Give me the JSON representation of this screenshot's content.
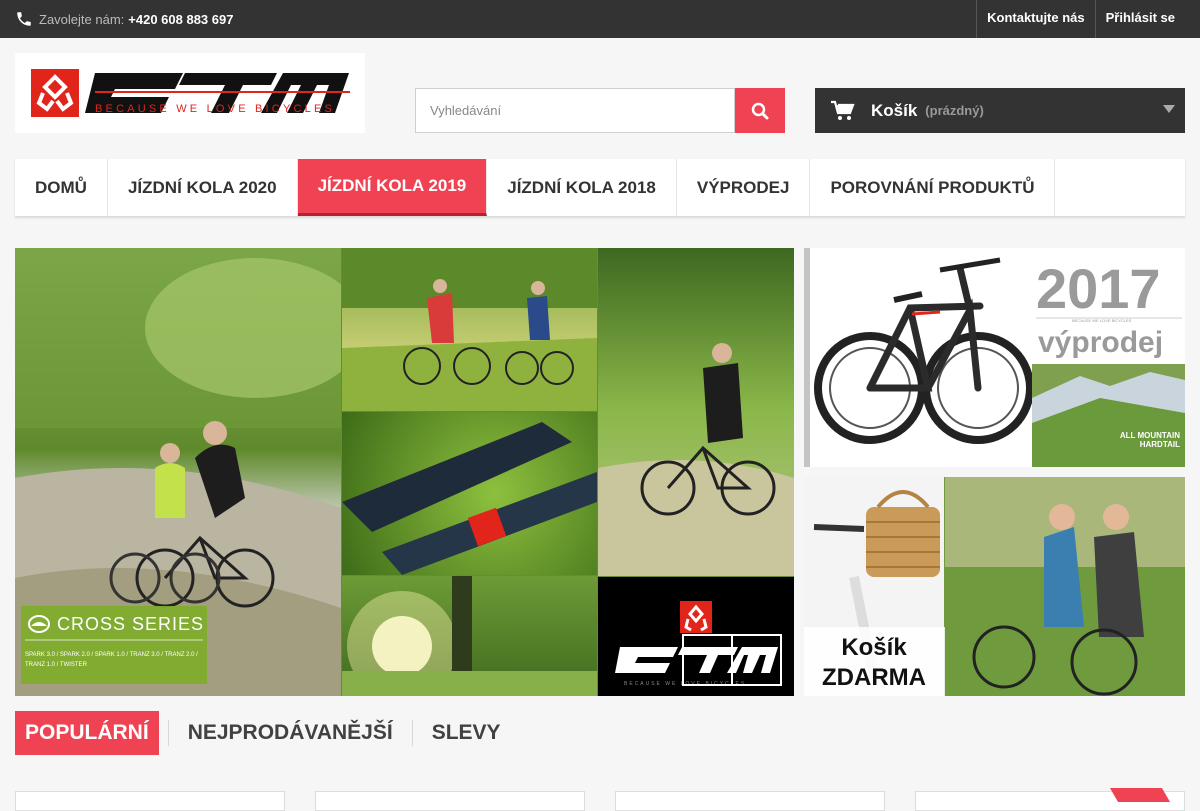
{
  "topbar": {
    "contact_label": "Zavolejte nám:",
    "phone": "+420 608 883 697",
    "links": [
      "Kontaktujte nás",
      "Přihlásit se"
    ]
  },
  "logo": {
    "brand": "CTM",
    "tagline": "BECAUSE WE LOVE BICYCLES"
  },
  "search": {
    "placeholder": "Vyhledávání",
    "icon": "search-icon"
  },
  "cart": {
    "title": "Košík",
    "status": "(prázdný)",
    "icon": "cart-icon"
  },
  "nav": {
    "items": [
      "DOMŮ",
      "JÍZDNÍ KOLA 2020",
      "JÍZDNÍ KOLA 2019",
      "JÍZDNÍ KOLA 2018",
      "VÝPRODEJ",
      "POROVNÁNÍ PRODUKTŮ"
    ],
    "active_index": 2
  },
  "slider": {
    "series_title": "CROSS SERIES",
    "series_models": "SPARK 3.0 / SPARK 2.0 / SPARK 1.0 / TRANZ 3.0 / TRANZ 2.0 / TRANZ 1.0 / TWISTER",
    "logo_brand": "CTM",
    "logo_tagline": "BECAUSE WE LOVE BICYCLES"
  },
  "banners": {
    "sale": {
      "year": "2017",
      "tagline": "BECAUSE WE LOVE BICYCLES",
      "title": "výprodej",
      "subtitle_line1": "ALL MOUNTAIN",
      "subtitle_line2": "HARDTAIL"
    },
    "basket": {
      "line1": "Košík",
      "line2": "ZDARMA"
    }
  },
  "tabs": {
    "items": [
      "POPULÁRNÍ",
      "NEJPRODÁVANĚJŠÍ",
      "SLEVY"
    ],
    "active_index": 0
  },
  "colors": {
    "accent": "#ef4354",
    "dark": "#333333"
  }
}
